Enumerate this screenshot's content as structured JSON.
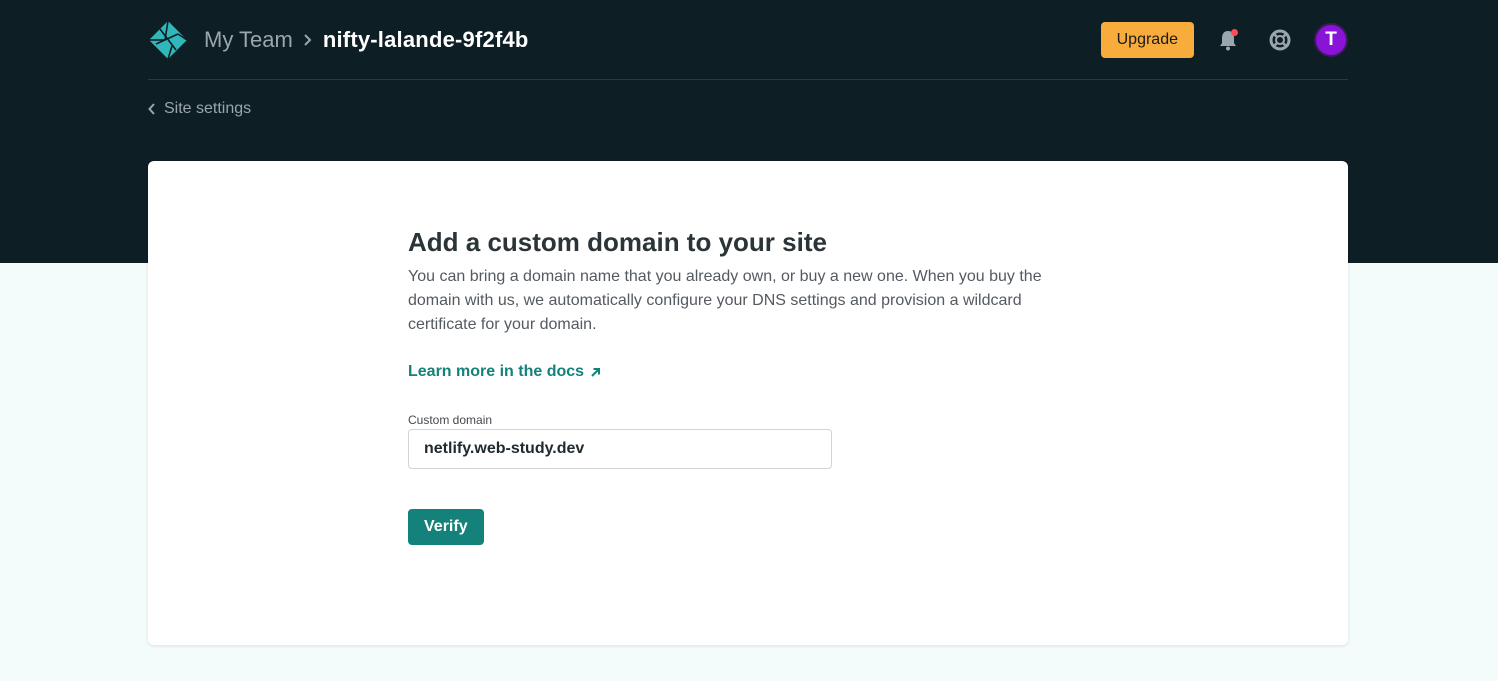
{
  "header": {
    "team_name": "My Team",
    "site_name": "nifty-lalande-9f2f4b",
    "upgrade_label": "Upgrade",
    "avatar_initial": "T",
    "has_notification": true,
    "icons": {
      "logo": "netlify-logo-icon",
      "bell": "bell-icon",
      "help": "lifebuoy-icon",
      "separator": "chevron-right-icon"
    }
  },
  "back_link": {
    "label": "Site settings",
    "icon": "chevron-left-icon"
  },
  "main": {
    "title": "Add a custom domain to your site",
    "description": "You can bring a domain name that you already own, or buy a new one. When you buy the domain with us, we automatically configure your DNS settings and provision a wildcard certificate for your domain.",
    "docs_link": "Learn more in the docs",
    "docs_link_icon": "arrow-up-right-icon",
    "field_label": "Custom domain",
    "field_value": "netlify.web-study.dev",
    "verify_label": "Verify"
  },
  "colors": {
    "header_bg": "#0e1e25",
    "accent": "#14827a",
    "upgrade": "#f7ac3b",
    "avatar": "#8a13d8"
  }
}
